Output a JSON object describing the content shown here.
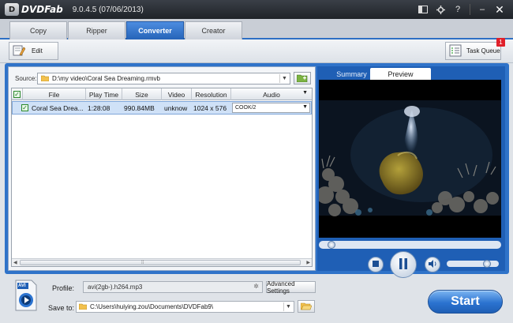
{
  "app": {
    "logo_mark": "D",
    "logo_text": "DVDFab",
    "version": "9.0.4.5 (07/06/2013)"
  },
  "titlebar_icons": [
    "layout-icon",
    "settings-icon",
    "help-icon",
    "minimize-icon",
    "close-icon"
  ],
  "titlebar": {
    "help": "?",
    "minimize": "–",
    "close": "✕"
  },
  "tabs": [
    {
      "label": "Copy",
      "active": false
    },
    {
      "label": "Ripper",
      "active": false
    },
    {
      "label": "Converter",
      "active": true
    },
    {
      "label": "Creator",
      "active": false
    }
  ],
  "toolbar": {
    "edit_label": "Edit",
    "task_queue_label": "Task Queue",
    "task_queue_badge": "1"
  },
  "source": {
    "label": "Source:",
    "path": "D:\\my video\\Coral Sea Dreaming.rmvb"
  },
  "table": {
    "columns": [
      "File",
      "Play Time",
      "Size",
      "Video",
      "Resolution",
      "Audio"
    ],
    "rows": [
      {
        "checked": true,
        "file": "Coral Sea Drea...",
        "play_time": "1:28:08",
        "size": "990.84MB",
        "video": "unknow",
        "resolution": "1024 x 576",
        "audio": "COOK/2"
      }
    ]
  },
  "preview_tabs": [
    {
      "label": "Summary",
      "active": false
    },
    {
      "label": "Preview",
      "active": true
    }
  ],
  "player": {
    "seek_position": 0.05,
    "volume": 0.82
  },
  "profile": {
    "label": "Profile:",
    "value": "avi(2gb-).h264.mp3",
    "advanced_label": "Advanced Settings",
    "icon_label": "AVI"
  },
  "save_to": {
    "label": "Save to:",
    "path": "C:\\Users\\huiying.zou\\Documents\\DVDFab9\\"
  },
  "start_label": "Start",
  "colors": {
    "accent": "#2f73c9",
    "active_tab": "#2563b8",
    "titlebar": "#2b2f35",
    "badge": "#e0202a",
    "checkbox": "#2d8a2d"
  }
}
